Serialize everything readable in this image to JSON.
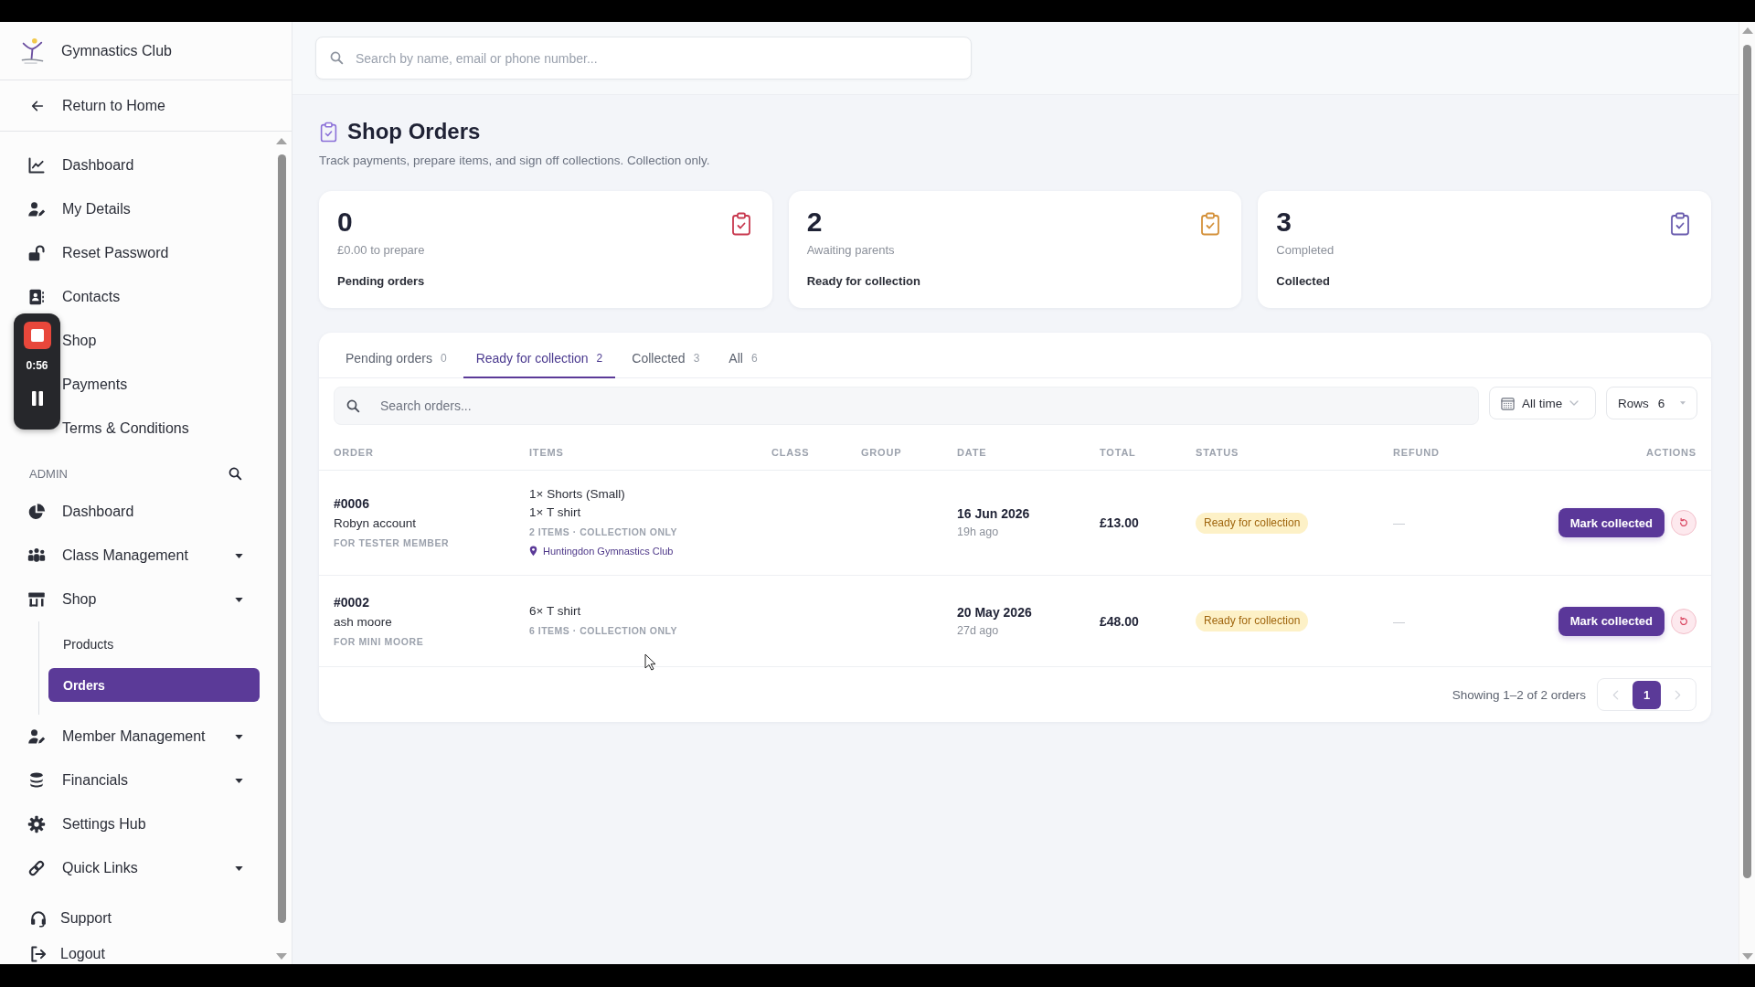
{
  "sidebar": {
    "brand": "Gymnastics Club",
    "return_link": "Return to Home",
    "items": [
      {
        "label": "Dashboard"
      },
      {
        "label": "My Details"
      },
      {
        "label": "Reset Password"
      },
      {
        "label": "Contacts"
      },
      {
        "label": "Shop"
      },
      {
        "label": "Payments"
      },
      {
        "label": "Terms & Conditions"
      }
    ],
    "admin": {
      "heading": "ADMIN",
      "items": [
        {
          "label": "Dashboard",
          "kind": "link"
        },
        {
          "label": "Class Management",
          "kind": "menu"
        },
        {
          "label": "Shop",
          "kind": "menu",
          "children": [
            {
              "label": "Products",
              "selected": false
            },
            {
              "label": "Orders",
              "selected": true
            }
          ]
        },
        {
          "label": "Member Management",
          "kind": "menu"
        },
        {
          "label": "Financials",
          "kind": "menu"
        },
        {
          "label": "Settings Hub",
          "kind": "link"
        },
        {
          "label": "Quick Links",
          "kind": "menu"
        }
      ]
    },
    "footer_items": [
      {
        "label": "Support"
      },
      {
        "label": "Logout"
      }
    ]
  },
  "screen_recorder": {
    "elapsed": "0:56"
  },
  "search": {
    "placeholder": "Search by name, email or phone number..."
  },
  "page": {
    "title": "Shop Orders",
    "subtitle": "Track payments, prepare items, and sign off collections. Collection only."
  },
  "stats": [
    {
      "value": "0",
      "detail": "£0.00 to prepare",
      "label": "Pending orders",
      "color": "#c8394f"
    },
    {
      "value": "2",
      "detail": "Awaiting parents",
      "label": "Ready for collection",
      "color": "#d4913a"
    },
    {
      "value": "3",
      "detail": "Completed",
      "label": "Collected",
      "color": "#6a5cae"
    }
  ],
  "orders_panel": {
    "tabs": [
      {
        "label": "Pending orders",
        "count": "0",
        "selected": false
      },
      {
        "label": "Ready for collection",
        "count": "2",
        "selected": true
      },
      {
        "label": "Collected",
        "count": "3",
        "selected": false
      },
      {
        "label": "All",
        "count": "6",
        "selected": false
      }
    ],
    "search": {
      "placeholder": "Search orders..."
    },
    "date_filter": "All time",
    "rows_select": {
      "label": "Rows",
      "value": "6"
    },
    "table": {
      "columns": [
        "ORDER",
        "ITEMS",
        "CLASS",
        "GROUP",
        "DATE",
        "TOTAL",
        "STATUS",
        "REFUND",
        "ACTIONS"
      ],
      "rows": [
        {
          "order": "#0006",
          "customer": "Robyn account",
          "member": "FOR TESTER MEMBER",
          "items": [
            "1× Shorts (Small)",
            "1× T shirt"
          ],
          "summary": "2 ITEMS · COLLECTION ONLY",
          "location": "Huntingdon Gymnastics Club",
          "date": "16 Jun 2026",
          "age": "19h ago",
          "total": "£13.00",
          "status": "Ready for collection",
          "refund": "—",
          "action": "Mark collected"
        },
        {
          "order": "#0002",
          "customer": "ash moore",
          "member": "FOR MINI MOORE",
          "items": [
            "6× T shirt"
          ],
          "summary": "6 ITEMS · COLLECTION ONLY",
          "date": "20 May 2026",
          "age": "27d ago",
          "total": "£48.00",
          "status": "Ready for collection",
          "refund": "—",
          "action": "Mark collected"
        }
      ]
    },
    "footer": {
      "summary": "Showing 1–2 of 2 orders",
      "previous": {
        "disabled": true
      },
      "pages": [
        {
          "label": "1",
          "selected": true
        }
      ],
      "next": {
        "disabled": true
      }
    }
  }
}
